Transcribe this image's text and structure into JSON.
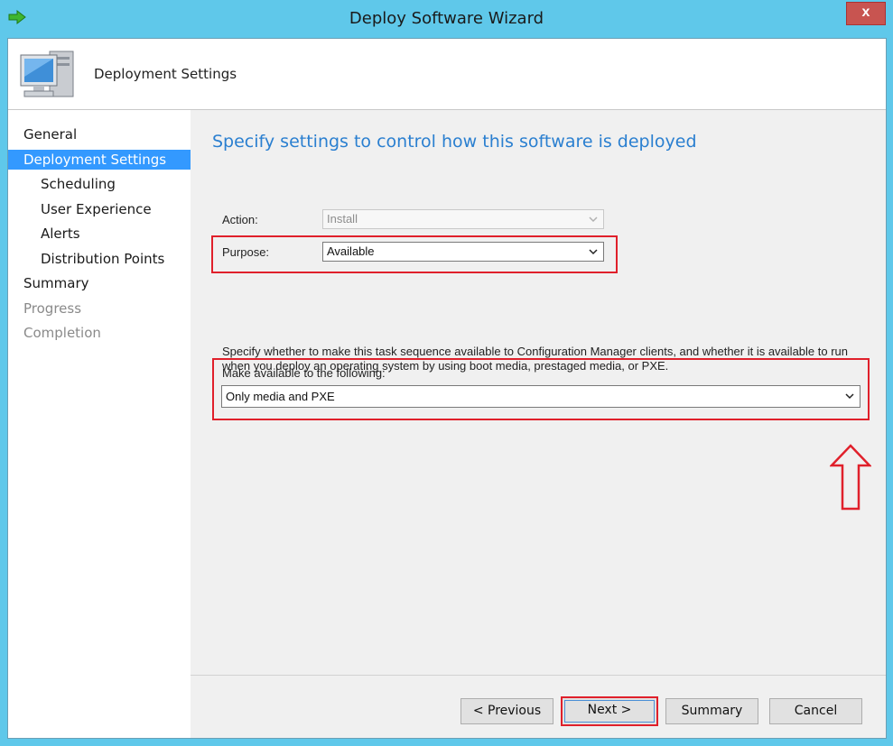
{
  "window": {
    "title": "Deploy Software Wizard",
    "close_label": "x"
  },
  "header": {
    "title": "Deployment Settings"
  },
  "nav": [
    {
      "label": "General",
      "level": "top",
      "state": "normal"
    },
    {
      "label": "Deployment Settings",
      "level": "top",
      "state": "active"
    },
    {
      "label": "Scheduling",
      "level": "sub",
      "state": "normal"
    },
    {
      "label": "User Experience",
      "level": "sub",
      "state": "normal"
    },
    {
      "label": "Alerts",
      "level": "sub",
      "state": "normal"
    },
    {
      "label": "Distribution Points",
      "level": "sub",
      "state": "normal"
    },
    {
      "label": "Summary",
      "level": "top",
      "state": "normal"
    },
    {
      "label": "Progress",
      "level": "top",
      "state": "disabled"
    },
    {
      "label": "Completion",
      "level": "top",
      "state": "disabled"
    }
  ],
  "main": {
    "heading": "Specify settings to control how this software is deployed",
    "action": {
      "label": "Action:",
      "value": "Install"
    },
    "purpose": {
      "label": "Purpose:",
      "value": "Available"
    },
    "description": "Specify whether to make this task sequence available to Configuration Manager clients, and whether it is available to run when you deploy an operating system by using boot media, prestaged media, or PXE.",
    "availability": {
      "label": "Make available to the following:",
      "value": "Only media and PXE"
    }
  },
  "buttons": {
    "previous": "< Previous",
    "next": "Next >",
    "summary": "Summary",
    "cancel": "Cancel"
  },
  "colors": {
    "accent": "#3399ff",
    "heading": "#2a7fd0",
    "highlight": "#e0202b",
    "titlebar": "#5fc8ea"
  },
  "icons": {
    "title": "green-arrow-icon",
    "header": "computer-icon"
  }
}
